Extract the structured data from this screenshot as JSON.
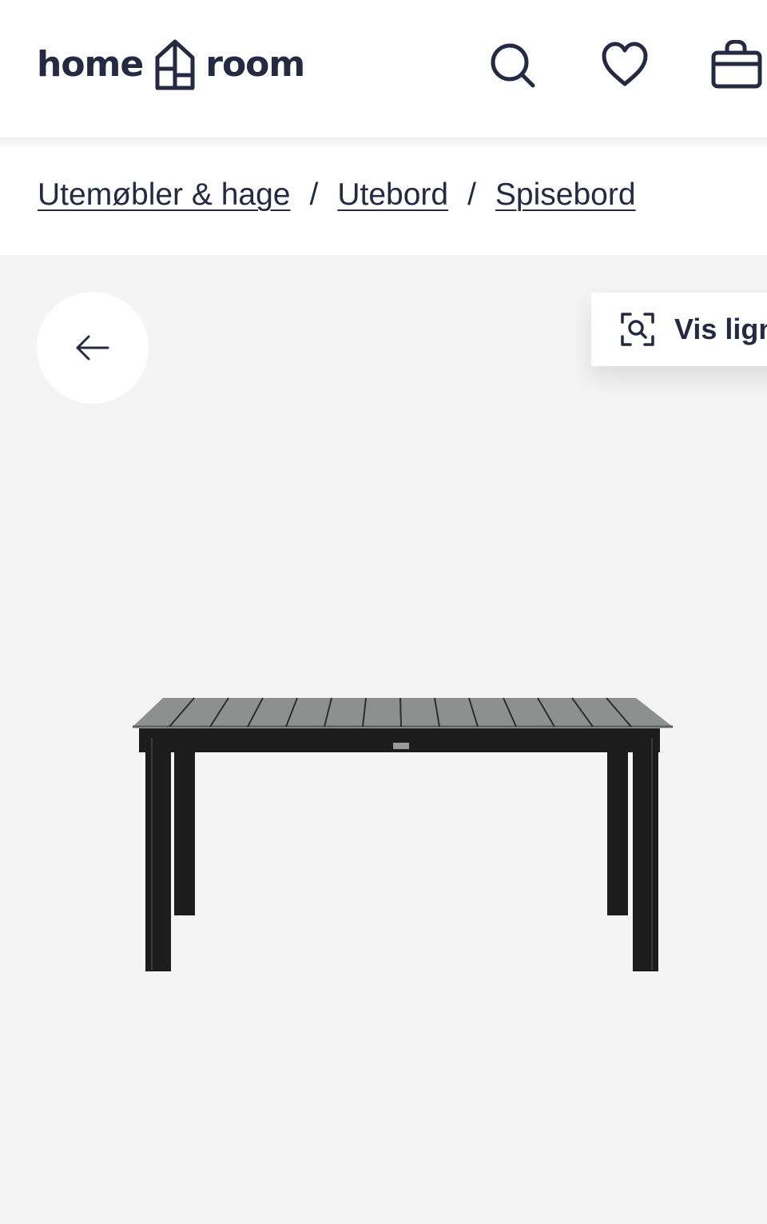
{
  "header": {
    "logo": {
      "word_left": "home",
      "word_right": "room",
      "icon": "house-icon"
    },
    "actions": [
      {
        "name": "search",
        "icon": "search-icon"
      },
      {
        "name": "favorites",
        "icon": "heart-icon"
      },
      {
        "name": "cart",
        "icon": "shopping-bag-icon"
      }
    ]
  },
  "breadcrumb": {
    "items": [
      "Utemøbler & hage",
      "Utebord",
      "Spisebord"
    ],
    "separator": "/"
  },
  "gallery": {
    "back_icon": "arrow-left-icon",
    "similar_button": {
      "label": "Vis lign",
      "icon": "visual-search-icon"
    },
    "product_image": "dining-table-photo"
  },
  "colors": {
    "brand": "#252941",
    "gallery_bg": "#f4f4f4",
    "table_top": "#8e8f8f",
    "table_frame": "#1c1c1c"
  }
}
